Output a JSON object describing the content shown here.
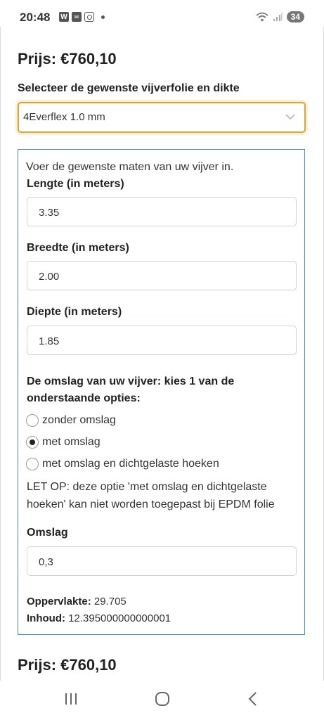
{
  "status_bar": {
    "time": "20:48",
    "left_icons": [
      "w-icon",
      "msg-icon",
      "instagram-icon"
    ],
    "battery": "34"
  },
  "price_top": "Prijs: €760,10",
  "select": {
    "label": "Selecteer de gewenste vijverfolie en dikte",
    "value": "4Everflex 1.0 mm"
  },
  "panel": {
    "intro": "Voer de gewenste maten van uw vijver in.",
    "fields": [
      {
        "label": "Lengte (in meters)",
        "value": "3.35"
      },
      {
        "label": "Breedte (in meters)",
        "value": "2.00"
      },
      {
        "label": "Diepte (in meters)",
        "value": "1.85"
      }
    ],
    "omslag_question": "De omslag van uw vijver: kies 1 van de onderstaande opties:",
    "options": [
      {
        "label": "zonder omslag",
        "checked": false
      },
      {
        "label": "met omslag",
        "checked": true
      },
      {
        "label": "met omslag en dichtgelaste hoeken",
        "checked": false
      }
    ],
    "warning": "LET OP: deze optie 'met omslag en dichtgelaste hoeken' kan niet worden toegepast bij EPDM folie",
    "omslag_label": "Omslag",
    "omslag_value": "0,3",
    "area_label": "Oppervlakte:",
    "area_value": "29.705",
    "volume_label": "Inhoud:",
    "volume_value": "12.395000000000001"
  },
  "price_bottom": "Prijs: €760,10",
  "colors": {
    "select_border": "#d9a43a",
    "panel_border": "#4a8fbf"
  }
}
